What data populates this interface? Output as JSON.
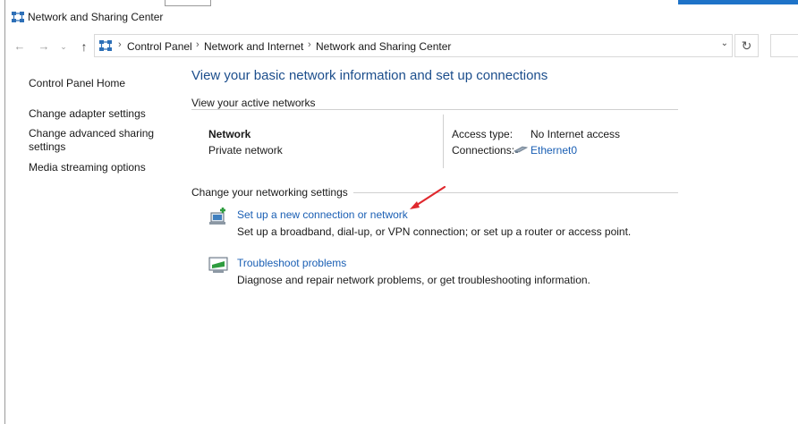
{
  "window": {
    "title": "Network and Sharing Center"
  },
  "navigation": {
    "back_icon": "arrow-left-icon",
    "forward_icon": "arrow-right-icon",
    "up_icon": "arrow-up-icon",
    "breadcrumbs": [
      "Control Panel",
      "Network and Internet",
      "Network and Sharing Center"
    ]
  },
  "left_pane": {
    "home": "Control Panel Home",
    "links": [
      "Change adapter settings",
      "Change advanced sharing settings",
      "Media streaming options"
    ]
  },
  "main": {
    "heading": "View your basic network information and set up connections",
    "active_networks_title": "View your active networks",
    "network": {
      "name": "Network",
      "type": "Private network",
      "access_type_label": "Access type:",
      "access_type_value": "No Internet access",
      "connections_label": "Connections:",
      "connections_value": "Ethernet0"
    },
    "change_settings_title": "Change your networking settings",
    "tasks": [
      {
        "label": "Set up a new connection or network",
        "description": "Set up a broadband, dial-up, or VPN connection; or set up a router or access point.",
        "icon": "new-connection-icon"
      },
      {
        "label": "Troubleshoot problems",
        "description": "Diagnose and repair network problems, or get troubleshooting information.",
        "icon": "troubleshoot-icon"
      }
    ]
  },
  "colors": {
    "heading": "#1c4e8c",
    "link": "#1a5fb4",
    "accent_strip": "#1e73c8",
    "annotation_arrow": "#e0282e"
  }
}
